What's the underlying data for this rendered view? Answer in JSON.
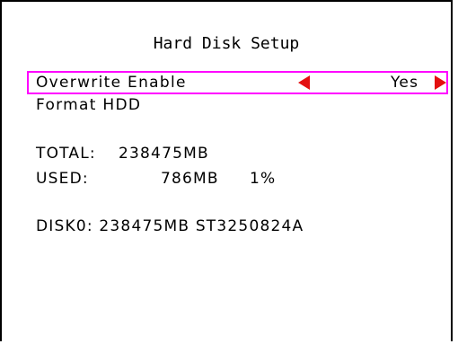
{
  "title": "Hard Disk Setup",
  "menu": {
    "overwrite": {
      "label": "Overwrite Enable",
      "value": "Yes"
    },
    "format": {
      "label": "Format HDD"
    }
  },
  "stats": {
    "total_label": "TOTAL:",
    "total_value": "238475MB",
    "used_label": "USED:",
    "used_value": "786MB",
    "used_percent": "1%"
  },
  "disk": {
    "info": "DISK0: 238475MB ST3250824A"
  },
  "colors": {
    "highlight": "#ff00ff",
    "arrow": "#e31010",
    "text": "#000000",
    "background": "#ffffff"
  },
  "icons": {
    "left": "left-arrow-icon",
    "right": "right-arrow-icon"
  }
}
